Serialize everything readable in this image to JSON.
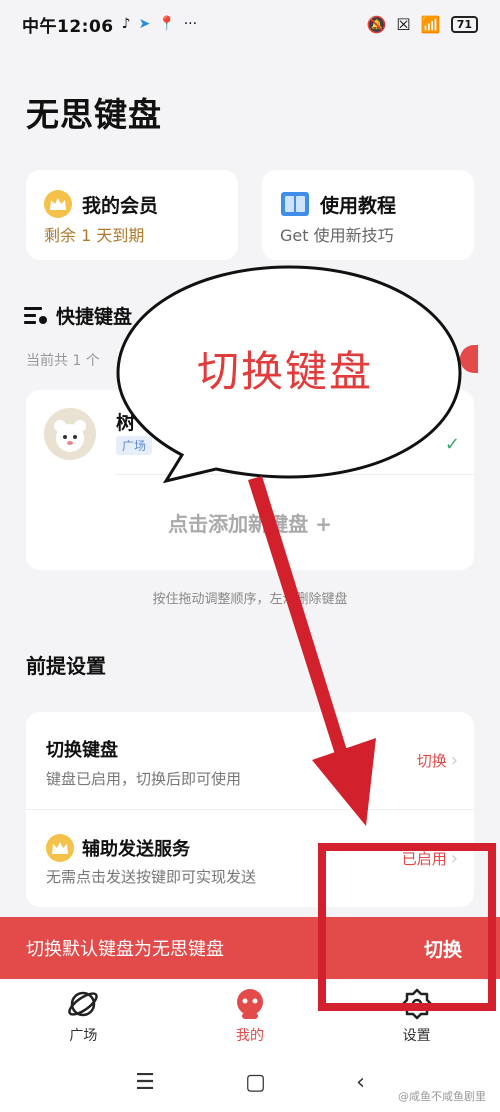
{
  "status": {
    "time": "中午12:06",
    "more": "···",
    "battery": "71"
  },
  "app": {
    "title": "无思键盘"
  },
  "cards": {
    "member": {
      "title": "我的会员",
      "subtitle": "剩余 1 天到期"
    },
    "tutorial": {
      "title": "使用教程",
      "subtitle": "Get 使用新技巧"
    }
  },
  "shortcut": {
    "title": "快捷键盘",
    "count_text": "当前共 1 个"
  },
  "keyboard": {
    "name": "树",
    "tag": "广场",
    "add_label": "点击添加新键盘 +"
  },
  "hint": "按住拖动调整顺序，左滑删除键盘",
  "prereq": {
    "title": "前提设置",
    "rows": [
      {
        "title": "切换键盘",
        "desc": "键盘已启用，切换后即可使用",
        "action": "切换"
      },
      {
        "title": "辅助发送服务",
        "desc": "无需点击发送按键即可实现发送",
        "action": "已启用"
      }
    ]
  },
  "switch_bar": {
    "text": "切换默认键盘为无思键盘",
    "button": "切换"
  },
  "nav": [
    {
      "label": "广场",
      "icon": "planet-icon"
    },
    {
      "label": "我的",
      "icon": "mascot-icon"
    },
    {
      "label": "设置",
      "icon": "gear-icon"
    }
  ],
  "system_nav": {
    "menu": "☰",
    "home": "▢",
    "back": "‹"
  },
  "watermark": "@咸鱼不咸鱼剧里",
  "annotation": {
    "bubble_text": "切换键盘"
  },
  "colors": {
    "accent": "#e34a4a",
    "annotation": "#d2212c",
    "member_gold": "#b07a2c"
  }
}
